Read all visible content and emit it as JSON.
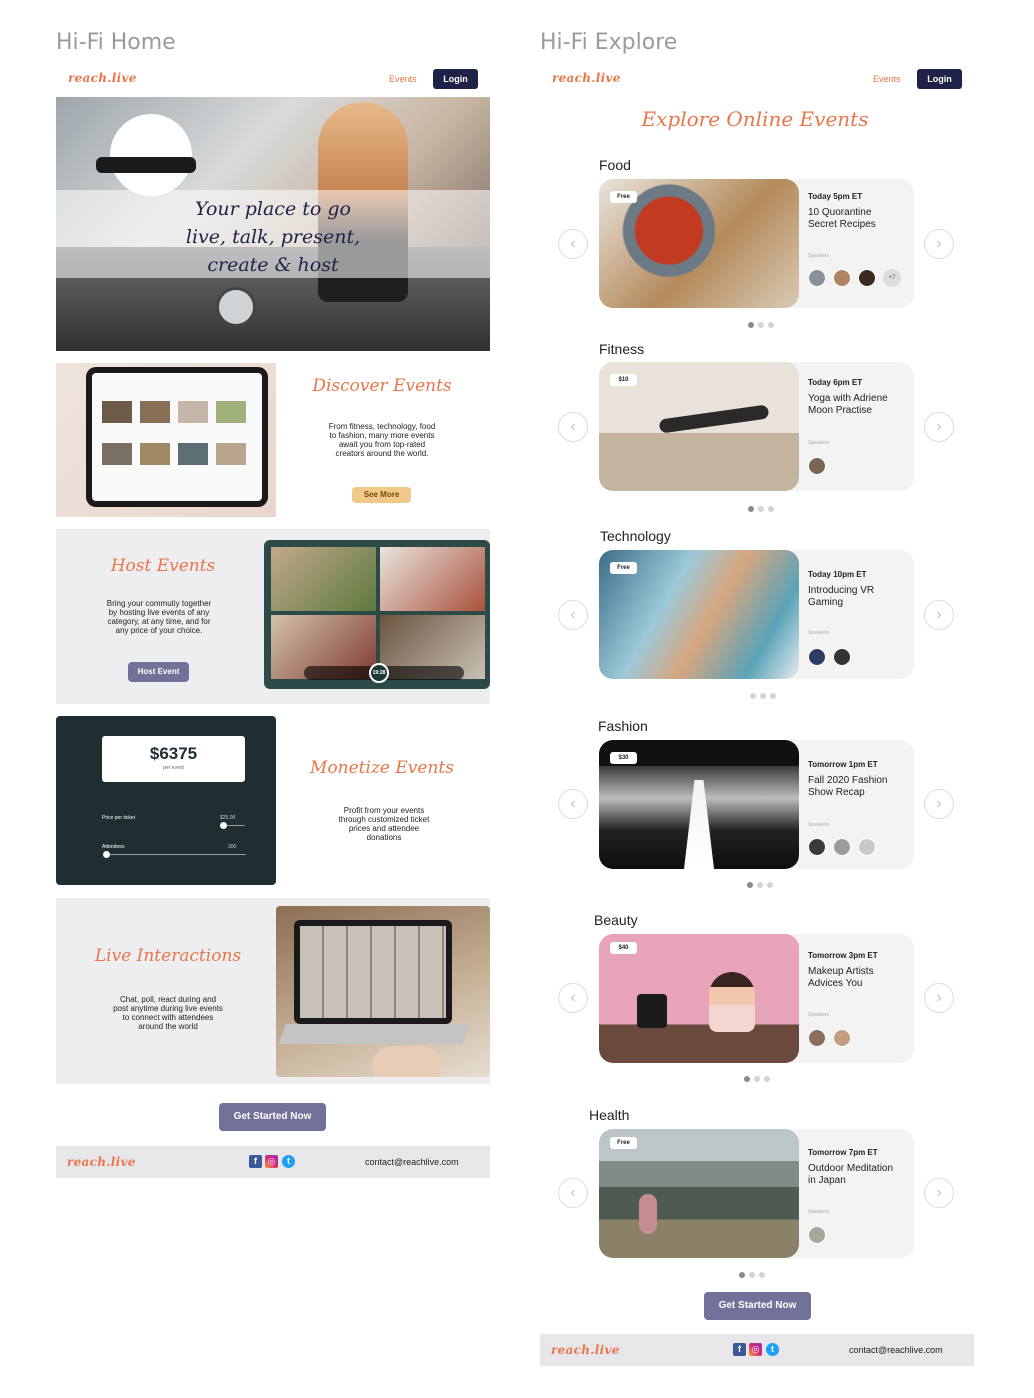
{
  "home": {
    "frame_title": "Hi-Fi Home",
    "nav": {
      "logo": "reach.live",
      "events": "Events",
      "login": "Login"
    },
    "hero": {
      "line1": "Your place to go",
      "line2": "live, talk, present,",
      "line3": "create & host"
    },
    "discover": {
      "title": "Discover Events",
      "body": "From fitness, technology, food to fashion, many more events await you from top-rated creators around the world.",
      "button": "See More"
    },
    "host": {
      "title": "Host Events",
      "body": "Bring your commutiy together by hosting live events of any category, at any time, and for any price of your choice.",
      "button": "Host Event",
      "timer": "19:28"
    },
    "monetize": {
      "title": "Monetize Events",
      "amount": "$6375",
      "per_event": "per event",
      "price_label": "Price per ticket",
      "price_value": "$25.00",
      "attendees_label": "Attendees",
      "attendees_value": "300",
      "body": "Profit from your events through customized ticket prices and attendee donations"
    },
    "live": {
      "title": "Live Interactions",
      "body": "Chat, poll, react during and post anytime during live events to connect with attendees around the world"
    },
    "cta": "Get Started Now",
    "footer": {
      "logo": "reach.live",
      "email": "contact@reachlive.com"
    }
  },
  "explore": {
    "frame_title": "Hi-Fi Explore",
    "nav": {
      "logo": "reach.live",
      "events": "Events",
      "login": "Login"
    },
    "heading": "Explore Online Events",
    "categories": [
      {
        "name": "Food",
        "price": "Free",
        "time": "Today 5pm ET",
        "title1": "10 Quorantine",
        "title2": "Secret Recipes",
        "speakers": "Speakers",
        "more": "+7"
      },
      {
        "name": "Fitness",
        "price": "$10",
        "time": "Today 6pm ET",
        "title1": "Yoga with Adriene",
        "title2": "Moon Practise",
        "speakers": "Speakers"
      },
      {
        "name": "Technology",
        "price": "Free",
        "time": "Today 10pm ET",
        "title1": "Introducing VR",
        "title2": "Gaming",
        "speakers": "Speakers"
      },
      {
        "name": "Fashion",
        "price": "$30",
        "time": "Tomorrow 1pm ET",
        "title1": "Fall 2020 Fashion",
        "title2": "Show Recap",
        "speakers": "Speakers"
      },
      {
        "name": "Beauty",
        "price": "$40",
        "time": "Tomorrow 3pm ET",
        "title1": "Makeup Artists",
        "title2": "Advices You",
        "speakers": "Speakers"
      },
      {
        "name": "Health",
        "price": "Free",
        "time": "Tomorrow 7pm ET",
        "title1": "Outdoor Meditation",
        "title2": "in Japan",
        "speakers": "Speakers"
      }
    ],
    "cta": "Get Started Now",
    "footer": {
      "logo": "reach.live",
      "email": "contact@reachlive.com"
    }
  },
  "icons": {
    "prev": "chevron-left-icon",
    "next": "chevron-right-icon",
    "facebook": "facebook-icon",
    "instagram": "instagram-icon",
    "twitter": "twitter-icon"
  },
  "colors": {
    "accent": "#e8764a",
    "navy": "#1e2247",
    "purple_button": "#72719a",
    "gold_button": "#f1c98a",
    "dark_teal": "#1f2e30",
    "footer_bg": "#e7e7e9"
  }
}
